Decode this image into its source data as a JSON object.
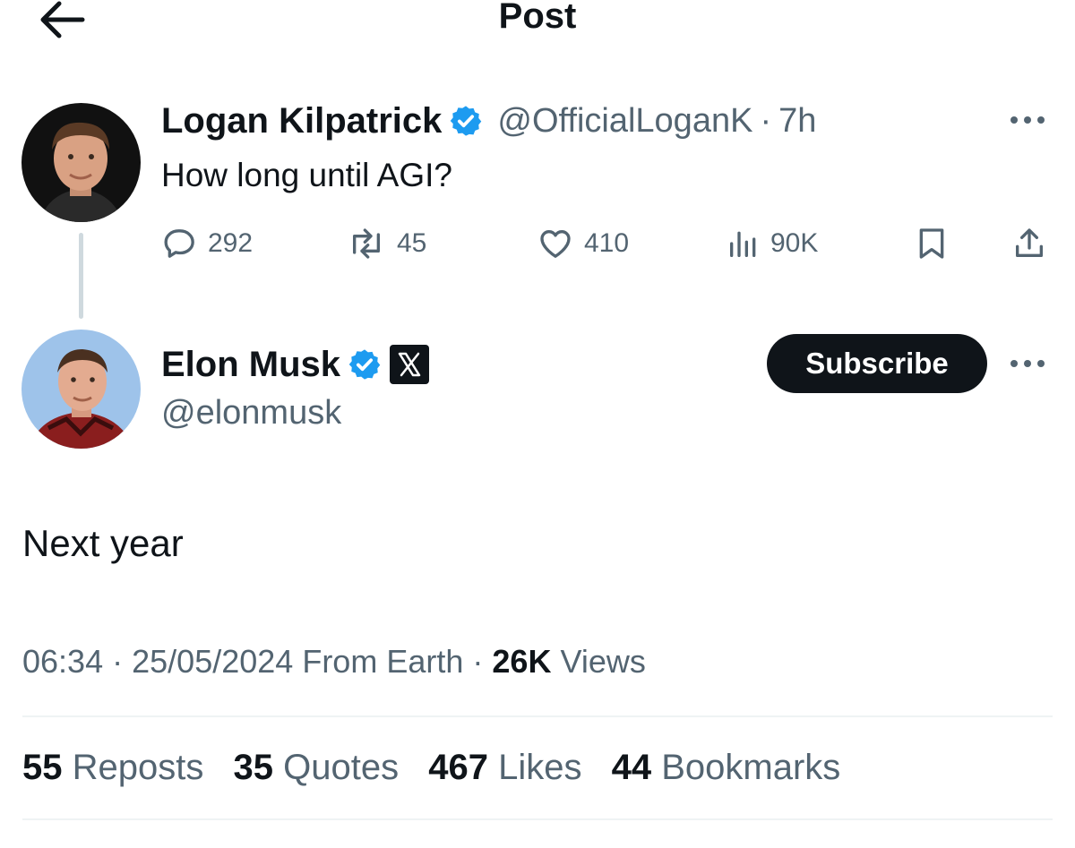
{
  "header": {
    "title": "Post"
  },
  "parent_post": {
    "author_name": "Logan Kilpatrick",
    "handle": "@OfficialLoganK",
    "separator": "·",
    "time": "7h",
    "text": "How long until AGI?",
    "replies": "292",
    "reposts": "45",
    "likes": "410",
    "views": "90K",
    "icons": [
      "reply-icon",
      "repost-icon",
      "like-icon",
      "views-icon",
      "bookmark-icon",
      "share-icon"
    ]
  },
  "main_post": {
    "author_name": "Elon Musk",
    "handle": "@elonmusk",
    "subscribe_label": "Subscribe",
    "text": "Next year",
    "time": "06:34",
    "date": "25/05/2024",
    "source": "From Earth",
    "sep": "·",
    "views_count": "26K",
    "views_label": "Views"
  },
  "stats": [
    {
      "count": "55",
      "label": "Reposts"
    },
    {
      "count": "35",
      "label": "Quotes"
    },
    {
      "count": "467",
      "label": "Likes"
    },
    {
      "count": "44",
      "label": "Bookmarks"
    }
  ],
  "colors": {
    "verified": "#1d9bf0",
    "text": "#0f1419",
    "muted": "#536471",
    "line": "#cfd9de"
  }
}
